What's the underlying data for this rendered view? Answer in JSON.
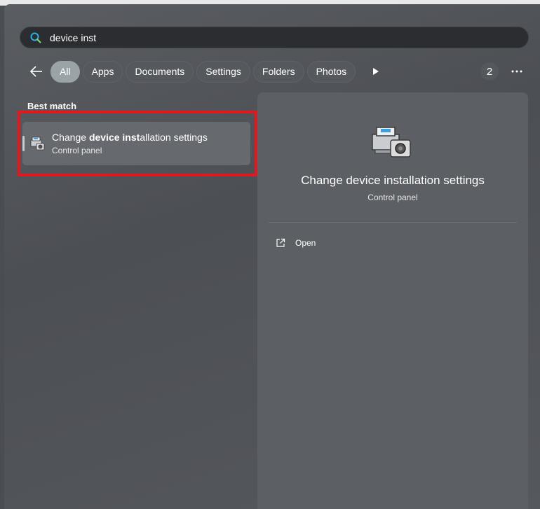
{
  "search": {
    "query": "device inst"
  },
  "filters": {
    "items": [
      "All",
      "Apps",
      "Documents",
      "Settings",
      "Folders",
      "Photos"
    ],
    "active": "All",
    "count": "2"
  },
  "results": {
    "section_label": "Best match",
    "best_match": {
      "title_prefix": "Change ",
      "title_bold": "device inst",
      "title_suffix": "allation settings",
      "subtitle": "Control panel",
      "icon": "device-installation-icon"
    }
  },
  "detail": {
    "title": "Change device installation settings",
    "subtitle": "Control panel",
    "actions": [
      {
        "label": "Open",
        "icon": "open-external-icon"
      }
    ]
  },
  "colors": {
    "highlight": "#e0181f",
    "active_chip": "#9aa3a8",
    "search_accent": "#2bb0e6"
  }
}
